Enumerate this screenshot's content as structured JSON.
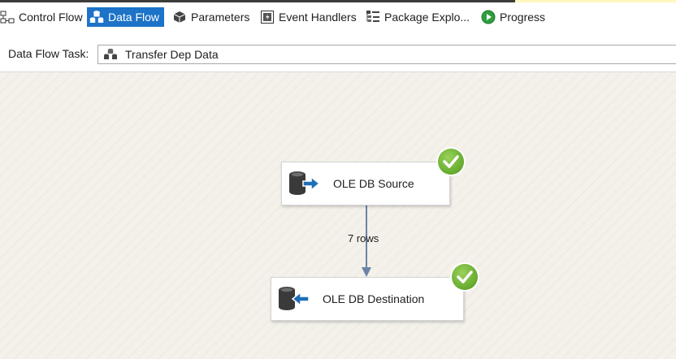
{
  "tabs": [
    {
      "label": "Control Flow",
      "icon": "control-flow-icon",
      "active": false
    },
    {
      "label": "Data Flow",
      "icon": "data-flow-icon",
      "active": true
    },
    {
      "label": "Parameters",
      "icon": "parameters-icon",
      "active": false
    },
    {
      "label": "Event Handlers",
      "icon": "event-handlers-icon",
      "active": false
    },
    {
      "label": "Package Explo...",
      "icon": "package-explorer-icon",
      "active": false
    },
    {
      "label": "Progress",
      "icon": "progress-play-icon",
      "active": false
    }
  ],
  "task": {
    "label": "Data Flow Task:",
    "value": "Transfer Dep Data",
    "icon": "data-flow-task-icon"
  },
  "components": [
    {
      "label": "OLE DB Source",
      "icon": "ole-db-source-icon",
      "status": "success"
    },
    {
      "label": "OLE DB Destination",
      "icon": "ole-db-destination-icon",
      "status": "success"
    }
  ],
  "path": {
    "label": "7 rows"
  },
  "colors": {
    "active_tab": "#1c73c8",
    "success_green": "#6cb033",
    "connector": "#6b84a6",
    "arrow_blue": "#1f6fb8"
  }
}
